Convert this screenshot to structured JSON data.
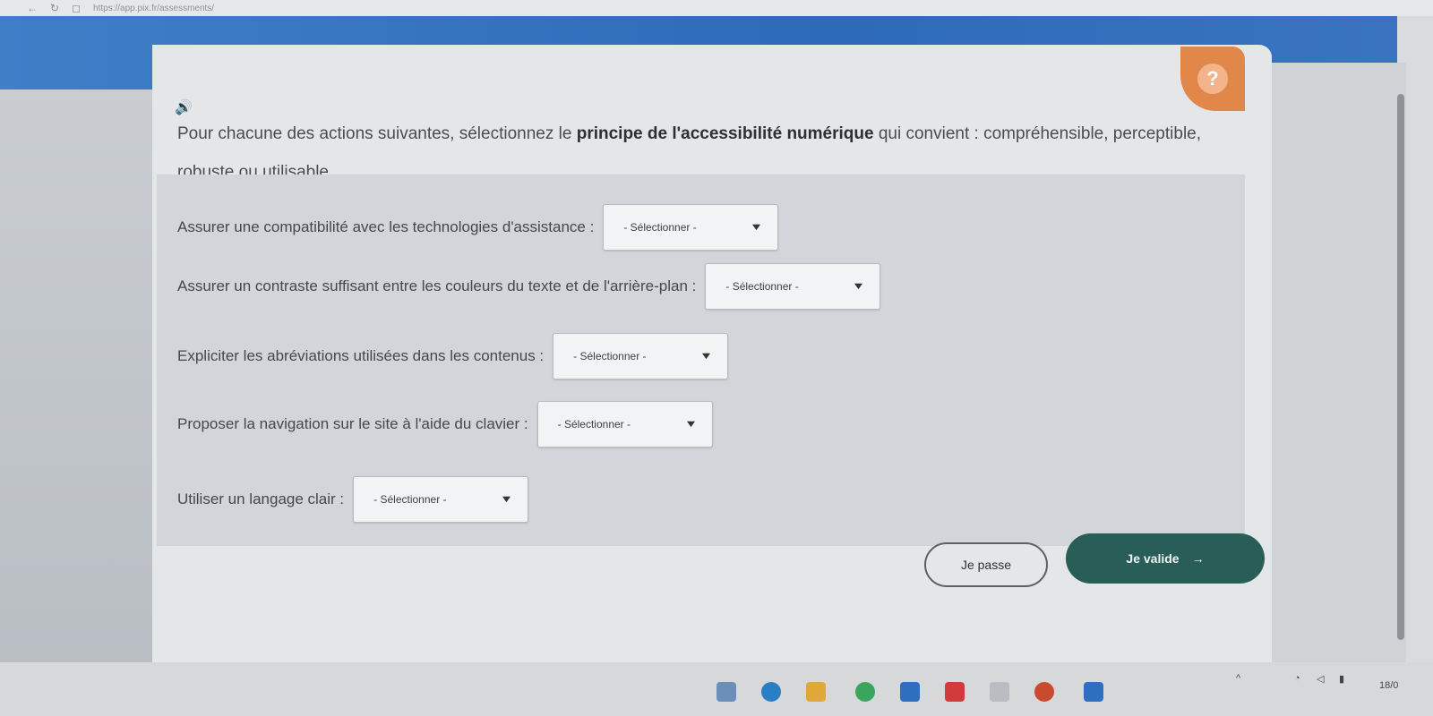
{
  "browser": {
    "url": "https://app.pix.fr/assessments/"
  },
  "question": {
    "text_before": "Pour chacune des actions suivantes, sélectionnez le ",
    "text_bold": "principe de l'accessibilité numérique",
    "text_after": " qui convient : compréhensible, perceptible, robuste ou utilisable."
  },
  "rows": [
    {
      "label": "Assurer une compatibilité avec les technologies d'assistance :",
      "select": "- Sélectionner -"
    },
    {
      "label": "Assurer un contraste suffisant entre les couleurs du texte et de l'arrière-plan :",
      "select": "- Sélectionner -"
    },
    {
      "label": "Expliciter les abréviations utilisées dans les contenus :",
      "select": "- Sélectionner -"
    },
    {
      "label": "Proposer la navigation sur le site à l'aide du clavier :",
      "select": "- Sélectionner -"
    },
    {
      "label": "Utiliser un langage clair :",
      "select": "- Sélectionner -"
    }
  ],
  "buttons": {
    "skip": "Je passe",
    "validate": "Je valide"
  },
  "help": {
    "label": "?"
  },
  "taskbar": {
    "date": "18/0"
  },
  "icons": {
    "speaker": "speaker-icon",
    "chevron": "chevron-down-icon",
    "arrow": "arrow-right-icon"
  }
}
